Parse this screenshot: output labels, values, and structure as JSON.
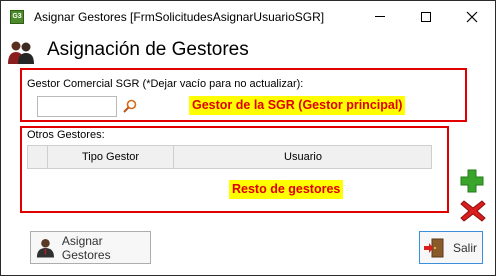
{
  "window": {
    "icon_text": "G3",
    "title": "Asignar Gestores [FrmSolicitudesAsignarUsuarioSGR]"
  },
  "header": {
    "title": "Asignación de Gestores"
  },
  "gestor": {
    "label": "Gestor Comercial SGR (*Dejar vacío para no actualizar):",
    "input_value": "",
    "annotation": "Gestor de la SGR   (Gestor principal)"
  },
  "otros": {
    "label": "Otros Gestores:",
    "columns": [
      "",
      "Tipo Gestor",
      "Usuario"
    ],
    "rows": [],
    "annotation": "Resto de gestores"
  },
  "buttons": {
    "asignar_label": "Asignar Gestores",
    "salir_label": "Salir"
  },
  "colors": {
    "annotation_red": "#e00000",
    "highlight_yellow": "#ffff00",
    "add_green": "#3aa52b",
    "delete_red": "#d81e1e"
  },
  "icons": [
    "app-icon",
    "people-icon",
    "search-icon",
    "add-icon",
    "delete-icon",
    "user-icon",
    "exit-door-icon"
  ]
}
